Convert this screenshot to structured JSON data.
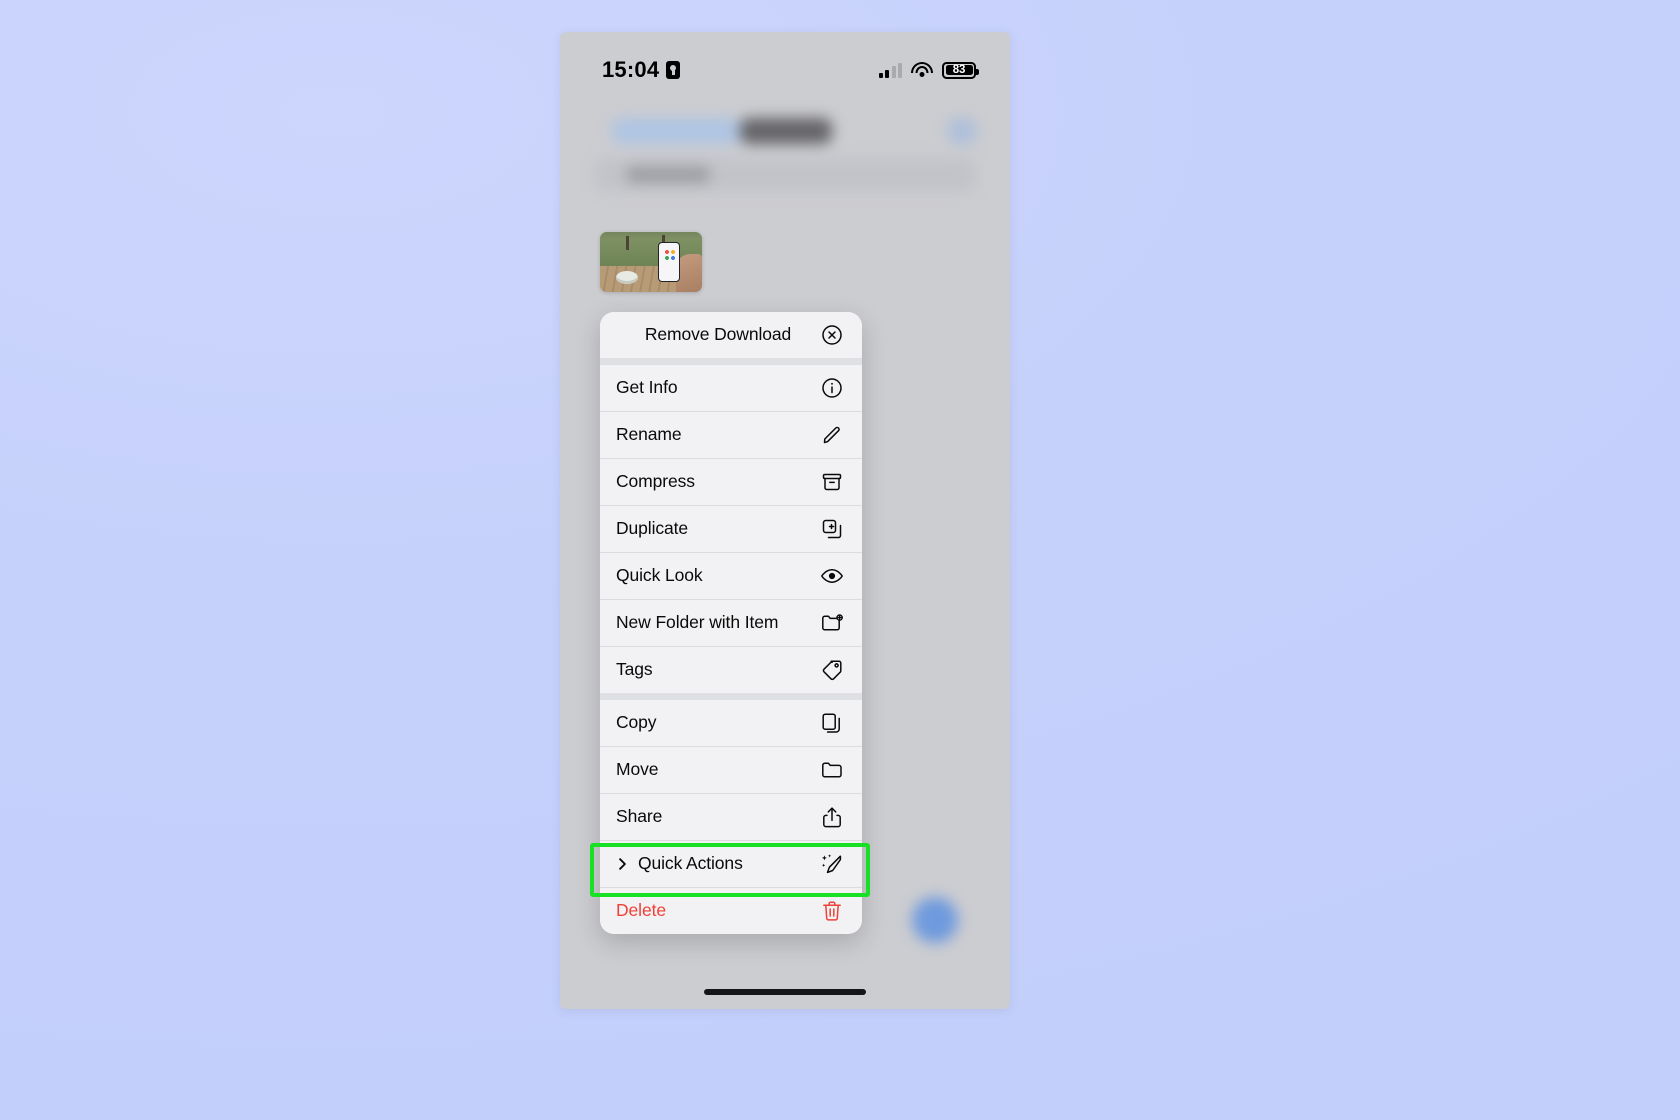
{
  "status_bar": {
    "time": "15:04",
    "lock_icon": "lock-portrait-orientation-icon",
    "cellular_icon": "cellular-signal-icon",
    "wifi_icon": "wifi-icon",
    "battery_percent": "83",
    "battery_icon": "battery-icon"
  },
  "background_app": {
    "name": "files-app-blurred",
    "back_button": "",
    "title": "",
    "search_placeholder": ""
  },
  "selected_file": {
    "thumbnail_name": "photo-thumbnail-park-bench-phone"
  },
  "context_menu": {
    "groups": [
      {
        "items": [
          {
            "label": "Remove Download",
            "icon": "remove-download-icon",
            "centered": true,
            "destructive": false,
            "submenu": false
          }
        ]
      },
      {
        "items": [
          {
            "label": "Get Info",
            "icon": "info-circle-icon",
            "centered": false,
            "destructive": false,
            "submenu": false
          },
          {
            "label": "Rename",
            "icon": "pencil-icon",
            "centered": false,
            "destructive": false,
            "submenu": false
          },
          {
            "label": "Compress",
            "icon": "archive-box-icon",
            "centered": false,
            "destructive": false,
            "submenu": false
          },
          {
            "label": "Duplicate",
            "icon": "duplicate-icon",
            "centered": false,
            "destructive": false,
            "submenu": false
          },
          {
            "label": "Quick Look",
            "icon": "eye-icon",
            "centered": false,
            "destructive": false,
            "submenu": false
          },
          {
            "label": "New Folder with Item",
            "icon": "folder-plus-icon",
            "centered": false,
            "destructive": false,
            "submenu": false
          },
          {
            "label": "Tags",
            "icon": "tag-icon",
            "centered": false,
            "destructive": false,
            "submenu": false
          }
        ]
      },
      {
        "items": [
          {
            "label": "Copy",
            "icon": "copy-icon",
            "centered": false,
            "destructive": false,
            "submenu": false
          },
          {
            "label": "Move",
            "icon": "folder-icon",
            "centered": false,
            "destructive": false,
            "submenu": false
          },
          {
            "label": "Share",
            "icon": "share-icon",
            "centered": false,
            "destructive": false,
            "submenu": false
          },
          {
            "label": "Quick Actions",
            "icon": "sparkles-wand-icon",
            "centered": false,
            "destructive": false,
            "submenu": true
          },
          {
            "label": "Delete",
            "icon": "trash-icon",
            "centered": false,
            "destructive": true,
            "submenu": false
          }
        ]
      }
    ]
  },
  "annotation": {
    "highlight_color": "#18e024",
    "highlight_target": "Quick Actions"
  },
  "home_indicator": "home-indicator"
}
